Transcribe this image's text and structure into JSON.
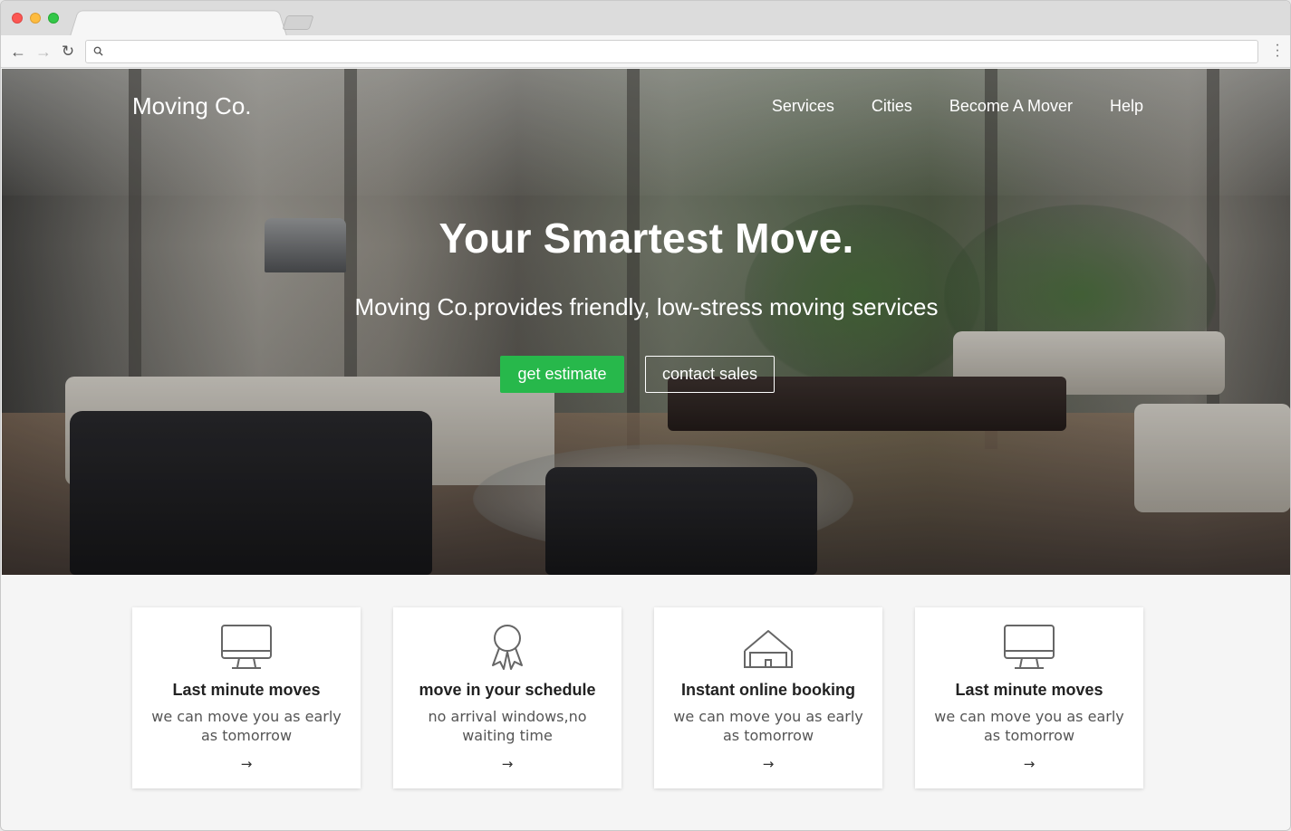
{
  "browser": {
    "url": "",
    "icons": [
      "back-arrow-icon",
      "forward-arrow-icon",
      "reload-icon",
      "search-icon",
      "menu-dots-icon"
    ]
  },
  "site": {
    "brand": "Moving Co.",
    "nav": [
      "Services",
      "Cities",
      "Become A Mover",
      "Help"
    ]
  },
  "hero": {
    "title": "Your Smartest Move.",
    "subtitle": "Moving Co.provides friendly, low-stress moving services",
    "primary_button": "get estimate",
    "secondary_button": "contact sales",
    "primary_color": "#27b84b"
  },
  "features": [
    {
      "icon": "monitor-icon",
      "title": "Last minute moves",
      "text": "we can move you as early as tomorrow",
      "arrow": "→"
    },
    {
      "icon": "award-ribbon-icon",
      "title": "move in your schedule",
      "text": "no arrival windows,no waiting time",
      "arrow": "→"
    },
    {
      "icon": "house-icon",
      "title": "Instant online booking",
      "text": "we can move you as early as tomorrow",
      "arrow": "→"
    },
    {
      "icon": "monitor-icon",
      "title": "Last minute moves",
      "text": "we can move you as early as tomorrow",
      "arrow": "→"
    }
  ]
}
